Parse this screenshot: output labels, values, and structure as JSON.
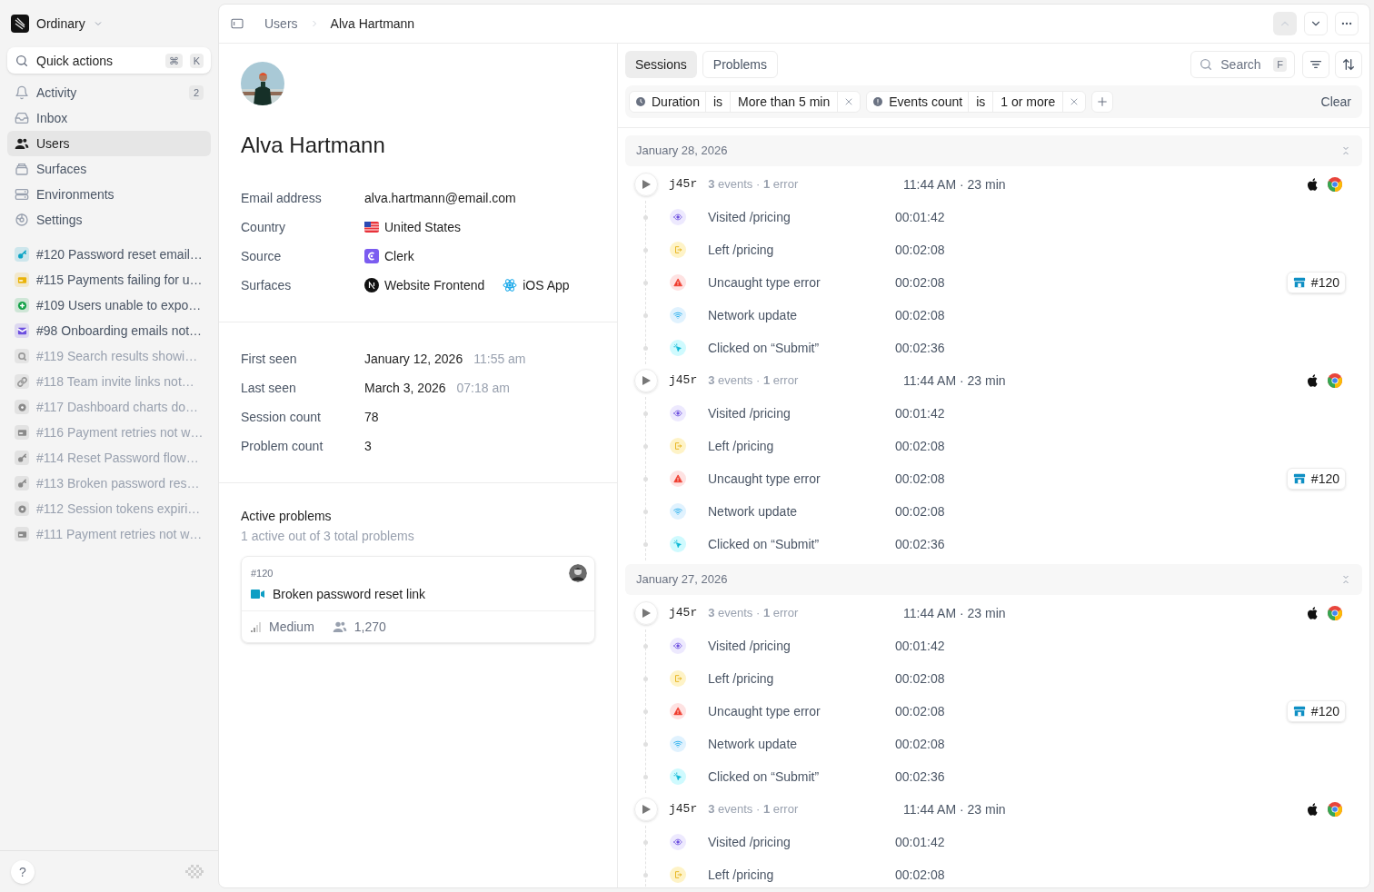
{
  "workspace": {
    "name": "Ordinary"
  },
  "quick_actions": {
    "label": "Quick actions",
    "keys": [
      "⌘",
      "K"
    ]
  },
  "nav": [
    {
      "kind": "bell",
      "label": "Activity",
      "badge": "2",
      "selected": false
    },
    {
      "kind": "inbox",
      "label": "Inbox",
      "selected": false
    },
    {
      "kind": "users",
      "label": "Users",
      "selected": true
    },
    {
      "kind": "stack",
      "label": "Surfaces",
      "selected": false
    },
    {
      "kind": "server",
      "label": "Environments",
      "selected": false
    },
    {
      "kind": "gear",
      "label": "Settings",
      "selected": false
    }
  ],
  "issues": [
    {
      "kind": "key",
      "color": "#0ea5c6",
      "label": "#120 Password reset email…",
      "muted": false
    },
    {
      "kind": "card",
      "color": "#eab308",
      "label": "#115 Payments failing for u…",
      "muted": false
    },
    {
      "kind": "plus",
      "color": "#16a34a",
      "label": "#109 Users unable to expo…",
      "muted": false
    },
    {
      "kind": "mail",
      "color": "#6d4fe0",
      "label": "#98 Onboarding emails not…",
      "muted": false
    },
    {
      "kind": "search",
      "color": "#9a9a9a",
      "label": "#119 Search results showi…",
      "muted": true
    },
    {
      "kind": "link",
      "color": "#9a9a9a",
      "label": "#118 Team invite links not…",
      "muted": true
    },
    {
      "kind": "dot",
      "color": "#8a8a8a",
      "label": "#117 Dashboard charts do…",
      "muted": true
    },
    {
      "kind": "card",
      "color": "#8a8a8a",
      "label": "#116 Payment retries not w…",
      "muted": true
    },
    {
      "kind": "key",
      "color": "#8a8a8a",
      "label": "#114 Reset Password flow…",
      "muted": true
    },
    {
      "kind": "key",
      "color": "#8a8a8a",
      "label": "#113 Broken password res…",
      "muted": true
    },
    {
      "kind": "dot",
      "color": "#8a8a8a",
      "label": "#112 Session tokens expiri…",
      "muted": true
    },
    {
      "kind": "card",
      "color": "#8a8a8a",
      "label": "#111 Payment retries not w…",
      "muted": true
    }
  ],
  "help": {
    "label": "?"
  },
  "breadcrumb": [
    "Users",
    "Alva Hartmann"
  ],
  "header_buttons": [
    {
      "kind": "up",
      "disabled": true
    },
    {
      "kind": "down",
      "disabled": false
    },
    {
      "kind": "more",
      "disabled": false
    }
  ],
  "profile": {
    "name": "Alva Hartmann",
    "fields": [
      {
        "label": "Email address",
        "values": [
          {
            "text": "alva.hartmann@email.com"
          }
        ]
      },
      {
        "label": "Country",
        "values": [
          {
            "kind": "flag",
            "text": "United States"
          }
        ]
      },
      {
        "label": "Source",
        "values": [
          {
            "kind": "clerk",
            "text": "Clerk"
          }
        ]
      },
      {
        "label": "Surfaces",
        "values": [
          {
            "kind": "nextjs",
            "text": "Website Frontend"
          },
          {
            "kind": "react",
            "text": "iOS App"
          }
        ]
      }
    ],
    "stats": [
      {
        "label": "First seen",
        "value": "January 12, 2026",
        "extra": "11:55 am"
      },
      {
        "label": "Last seen",
        "value": "March 3, 2026",
        "extra": "07:18 am"
      },
      {
        "label": "Session count",
        "value": "78"
      },
      {
        "label": "Problem count",
        "value": "3"
      }
    ]
  },
  "active_problems": {
    "title": "Active problems",
    "subtitle": "1 active out of 3 total problems",
    "card": {
      "number": "#120",
      "title": "Broken password reset link",
      "severity": "Medium",
      "users": "1,270"
    }
  },
  "tabs": [
    {
      "label": "Sessions",
      "selected": true
    },
    {
      "label": "Problems",
      "selected": false
    }
  ],
  "search": {
    "placeholder": "Search",
    "shortcut": "F"
  },
  "filters": [
    {
      "kind": "clock",
      "field": "Duration",
      "operator": "is",
      "value": "More than 5 min"
    },
    {
      "kind": "alert",
      "field": "Events count",
      "operator": "is",
      "value": "1 or more"
    }
  ],
  "clear": "Clear",
  "session_groups": [
    {
      "date": "January 28, 2026",
      "sessions": [
        {
          "id": "j45r",
          "summary": "**3** events · **1** error",
          "time": "11:44 AM · 23 min",
          "events": [
            {
              "kind": "visit",
              "label": "Visited /pricing",
              "time": "00:01:42"
            },
            {
              "kind": "leave",
              "label": "Left /pricing",
              "time": "00:02:08"
            },
            {
              "kind": "error",
              "label": "Uncaught type error",
              "time": "00:02:08",
              "problem": "#120"
            },
            {
              "kind": "network",
              "label": "Network update",
              "time": "00:02:08"
            },
            {
              "kind": "click",
              "label": "Clicked on “Submit”",
              "time": "00:02:36"
            }
          ]
        },
        {
          "id": "j45r",
          "summary": "**3** events · **1** error",
          "time": "11:44 AM · 23 min",
          "events": [
            {
              "kind": "visit",
              "label": "Visited /pricing",
              "time": "00:01:42"
            },
            {
              "kind": "leave",
              "label": "Left /pricing",
              "time": "00:02:08"
            },
            {
              "kind": "error",
              "label": "Uncaught type error",
              "time": "00:02:08",
              "problem": "#120"
            },
            {
              "kind": "network",
              "label": "Network update",
              "time": "00:02:08"
            },
            {
              "kind": "click",
              "label": "Clicked on “Submit”",
              "time": "00:02:36"
            }
          ]
        }
      ]
    },
    {
      "date": "January 27, 2026",
      "sessions": [
        {
          "id": "j45r",
          "summary": "**3** events · **1** error",
          "time": "11:44 AM · 23 min",
          "events": [
            {
              "kind": "visit",
              "label": "Visited /pricing",
              "time": "00:01:42"
            },
            {
              "kind": "leave",
              "label": "Left /pricing",
              "time": "00:02:08"
            },
            {
              "kind": "error",
              "label": "Uncaught type error",
              "time": "00:02:08",
              "problem": "#120"
            },
            {
              "kind": "network",
              "label": "Network update",
              "time": "00:02:08"
            },
            {
              "kind": "click",
              "label": "Clicked on “Submit”",
              "time": "00:02:36"
            }
          ]
        },
        {
          "id": "j45r",
          "summary": "**3** events · **1** error",
          "time": "11:44 AM · 23 min",
          "events": [
            {
              "kind": "visit",
              "label": "Visited /pricing",
              "time": "00:01:42"
            },
            {
              "kind": "leave",
              "label": "Left /pricing",
              "time": "00:02:08"
            }
          ]
        }
      ]
    }
  ]
}
